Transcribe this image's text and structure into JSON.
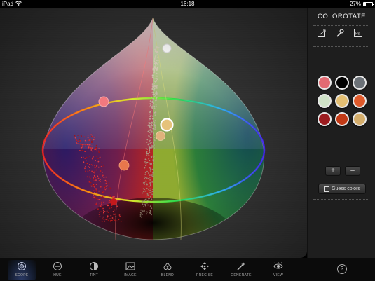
{
  "status_bar": {
    "device": "iPad",
    "time": "16:18",
    "battery": "27%",
    "battery_level": 0.27
  },
  "app": {
    "title": "COLOROTATE"
  },
  "side_tools": [
    {
      "icon": "share-icon"
    },
    {
      "icon": "wrench-icon"
    },
    {
      "icon": "photoshop-icon",
      "text": "Ps"
    }
  ],
  "swatches": [
    {
      "color": "#e26a72"
    },
    {
      "color": "#000000"
    },
    {
      "color": "#6b7177"
    },
    {
      "color": "#cfe2c7"
    },
    {
      "color": "#e4bf73"
    },
    {
      "color": "#e05a2b"
    },
    {
      "color": "#9b1c1f"
    },
    {
      "color": "#c23a16"
    },
    {
      "color": "#d4ad6b"
    }
  ],
  "side_actions": {
    "plus": "+",
    "minus": "–",
    "guess_label": "Guess colors"
  },
  "toolbar": [
    {
      "label": "SCOPE",
      "icon": "scope-icon",
      "active": true
    },
    {
      "label": "HUE",
      "icon": "hue-icon"
    },
    {
      "label": "TINT",
      "icon": "tint-icon"
    },
    {
      "label": "IMAGE",
      "icon": "image-icon"
    },
    {
      "label": "BLEND",
      "icon": "blend-icon"
    },
    {
      "label": "PRECISE",
      "icon": "precise-icon"
    },
    {
      "label": "GENERATE",
      "icon": "generate-icon"
    },
    {
      "label": "VIEW",
      "icon": "view-icon"
    }
  ],
  "help_label": "?",
  "colors": {
    "accent_active": "#2b3a66",
    "selected_ring": "#ffffff"
  }
}
